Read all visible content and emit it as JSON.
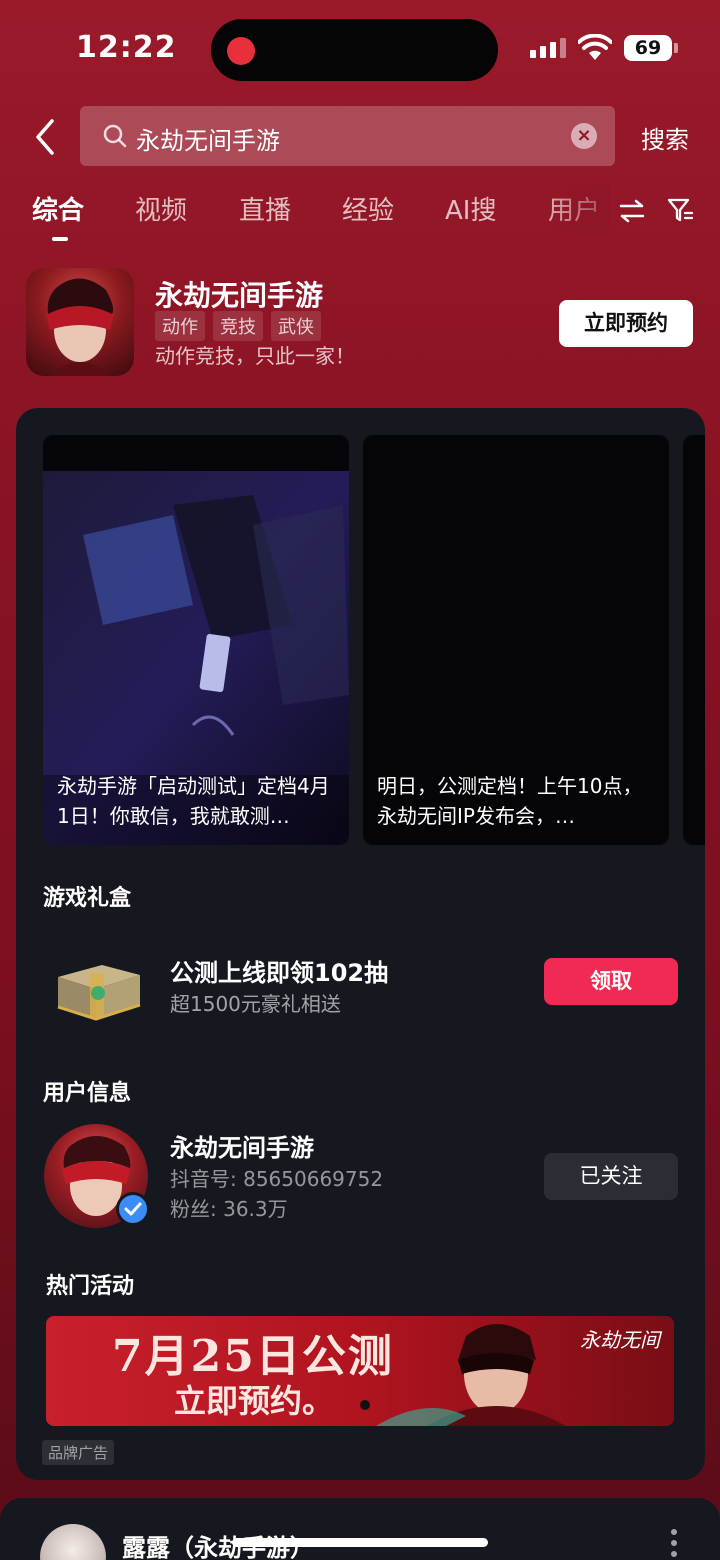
{
  "status_bar": {
    "time": "12:22",
    "battery": "69"
  },
  "search": {
    "query": "永劫无间手游",
    "button": "搜索"
  },
  "tabs": [
    {
      "label": "综合",
      "active": true
    },
    {
      "label": "视频"
    },
    {
      "label": "直播"
    },
    {
      "label": "经验"
    },
    {
      "label": "AI搜"
    },
    {
      "label": "用户"
    }
  ],
  "game": {
    "title": "永劫无间手游",
    "tags": [
      "动作",
      "竞技",
      "武侠"
    ],
    "slogan": "动作竞技，只此一家！",
    "reserve_label": "立即预约"
  },
  "videos": [
    {
      "caption": "永劫手游「启动测试」定档4月1日！你敢信，我就敢测…"
    },
    {
      "caption": "明日，公测定档！上午10点，永劫无间IP发布会，…"
    }
  ],
  "gift_section": {
    "title": "游戏礼盒",
    "gift_title": "公测上线即领102抽",
    "gift_subtitle": "超1500元豪礼相送",
    "claim_label": "领取"
  },
  "user_section": {
    "title": "用户信息",
    "name": "永劫无间手游",
    "douyin_id": "抖音号: 85650669752",
    "fans": "粉丝: 36.3万",
    "follow_label": "已关注"
  },
  "activity_section": {
    "title": "热门活动",
    "banner_line1": "7月25日公测",
    "banner_line2": "立即预约。",
    "banner_logo": "永劫无间",
    "ad_tag": "品牌广告"
  },
  "next_card": {
    "name": "露露（永劫手游）"
  },
  "colors": {
    "accent": "#f02a52",
    "background": "#8a1324",
    "card": "#16181f"
  }
}
